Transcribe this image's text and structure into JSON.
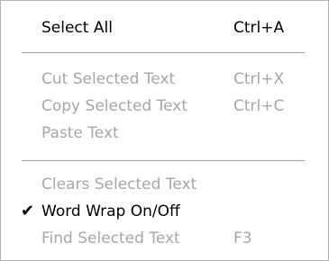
{
  "menu": {
    "items": [
      {
        "label": "Select All",
        "shortcut": "Ctrl+A",
        "enabled": true,
        "checked": false
      },
      {
        "label": "Cut Selected Text",
        "shortcut": "Ctrl+X",
        "enabled": false,
        "checked": false
      },
      {
        "label": "Copy Selected Text",
        "shortcut": "Ctrl+C",
        "enabled": false,
        "checked": false
      },
      {
        "label": "Paste Text",
        "shortcut": "",
        "enabled": false,
        "checked": false
      },
      {
        "label": "Clears Selected Text",
        "shortcut": "",
        "enabled": false,
        "checked": false
      },
      {
        "label": "Word Wrap On/Off",
        "shortcut": "",
        "enabled": true,
        "checked": true,
        "check_glyph": "✔"
      },
      {
        "label": "Find Selected Text",
        "shortcut": "F3",
        "enabled": false,
        "checked": false
      }
    ]
  },
  "colors": {
    "enabled_text": "#000000",
    "disabled_text": "#a7a7a7",
    "separator": "#a0a0a0"
  }
}
